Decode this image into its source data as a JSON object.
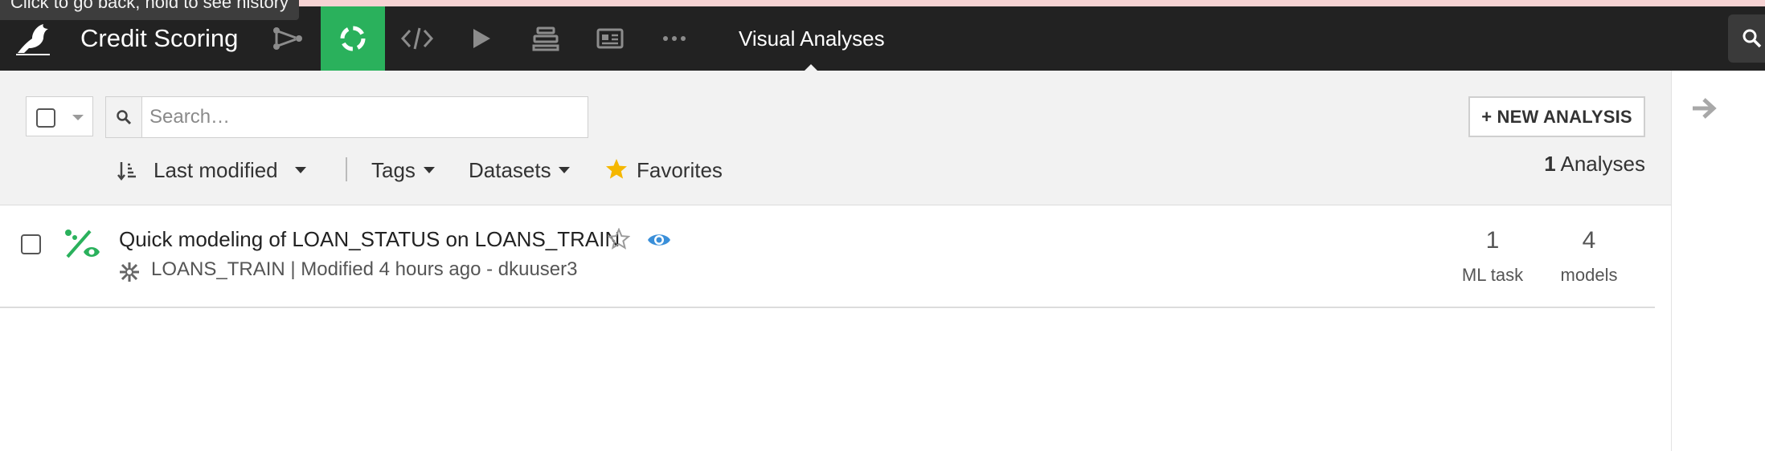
{
  "tooltip": "Click to go back, hold to see history",
  "header": {
    "project_name": "Credit Scoring",
    "section_title": "Visual Analyses",
    "nav_icons": [
      "flow-icon",
      "lab-icon",
      "code-icon",
      "run-icon",
      "deploy-icon",
      "dashboard-icon",
      "more-icon"
    ],
    "active_nav": "lab-icon",
    "accent_color": "#2ab15c"
  },
  "filters": {
    "search_placeholder": "Search…",
    "new_analysis_label": "+ NEW ANALYSIS",
    "sort_label": "Last modified",
    "tags_label": "Tags",
    "datasets_label": "Datasets",
    "favorites_label": "Favorites",
    "count_number": "1",
    "count_label": "Analyses"
  },
  "analyses": [
    {
      "title": "Quick modeling of LOAN_STATUS on LOANS_TRAIN",
      "meta": "LOANS_TRAIN | Modified 4 hours ago - dkuuser3",
      "ml_task_count": "1",
      "ml_task_label": "ML task",
      "models_count": "4",
      "models_label": "models"
    }
  ]
}
